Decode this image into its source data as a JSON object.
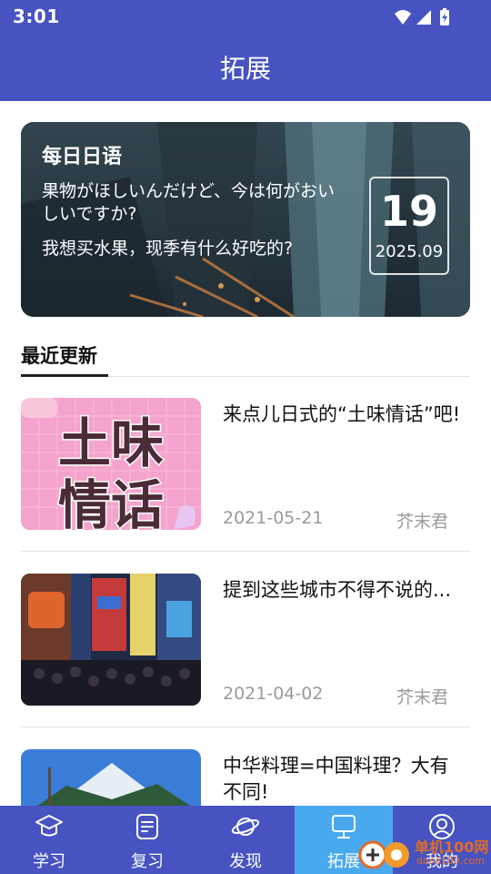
{
  "status": {
    "time": "3:01"
  },
  "header": {
    "title": "拓展"
  },
  "banner": {
    "heading": "每日日语",
    "japanese": "果物がほしいんだけど、今は何がおいしいですか?",
    "chinese": "我想买水果，现季有什么好吃的?",
    "day": "19",
    "year_month": "2025.09"
  },
  "section": {
    "label": "最近更新"
  },
  "articles": [
    {
      "title": "来点儿日式的“土味情话”吧!",
      "date": "2021-05-21",
      "author": "芥末君",
      "thumb_text_1": "土味",
      "thumb_text_2": "情话"
    },
    {
      "title": "提到这些城市不得不说的...",
      "date": "2021-04-02",
      "author": "芥末君"
    },
    {
      "title": "中华料理=中国料理？大有不同!",
      "date": "",
      "author": ""
    }
  ],
  "nav": [
    {
      "label": "学习",
      "icon": "graduation-cap-icon"
    },
    {
      "label": "复习",
      "icon": "document-icon"
    },
    {
      "label": "发现",
      "icon": "planet-icon"
    },
    {
      "label": "拓展",
      "icon": "monitor-icon"
    },
    {
      "label": "我的",
      "icon": "user-icon"
    }
  ],
  "colors": {
    "primary": "#4653c1",
    "active_tab": "#49a9ef",
    "muted_text": "#9a9a9a"
  },
  "watermark": {
    "text": "单机100网",
    "sub": "danji100.com"
  }
}
